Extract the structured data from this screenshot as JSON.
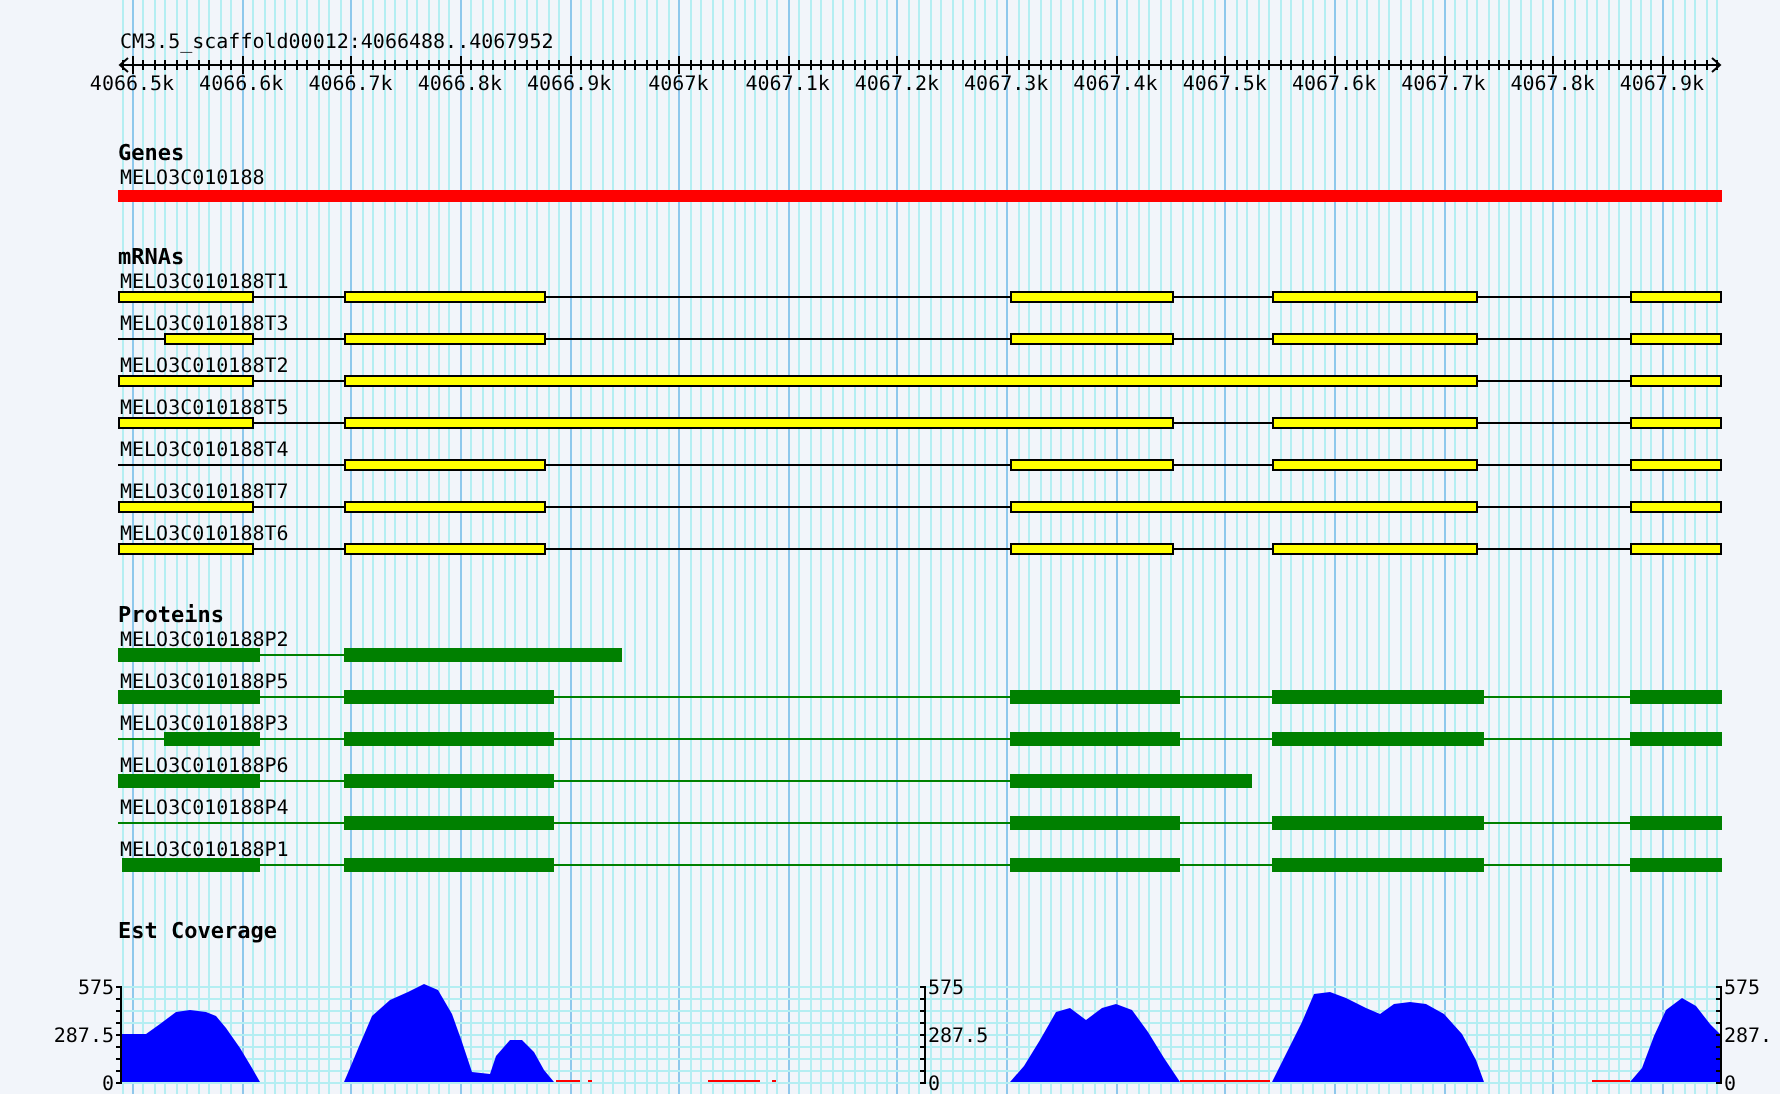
{
  "ruler": {
    "title": "CM3.5_scaffold00012:4066488..4067952",
    "ticks": [
      "4066.5k",
      "4066.6k",
      "4066.7k",
      "4066.8k",
      "4066.9k",
      "4067k",
      "4067.1k",
      "4067.2k",
      "4067.3k",
      "4067.4k",
      "4067.5k",
      "4067.6k",
      "4067.7k",
      "4067.8k",
      "4067.9k"
    ]
  },
  "tracks": [
    {
      "kind": "gene",
      "title": "Genes",
      "features": [
        {
          "label": "MELO3C010188"
        }
      ]
    },
    {
      "kind": "mrna",
      "title": "mRNAs",
      "features": [
        {
          "label": "MELO3C010188T1"
        },
        {
          "label": "MELO3C010188T3"
        },
        {
          "label": "MELO3C010188T2"
        },
        {
          "label": "MELO3C010188T5"
        },
        {
          "label": "MELO3C010188T4"
        },
        {
          "label": "MELO3C010188T7"
        },
        {
          "label": "MELO3C010188T6"
        }
      ]
    },
    {
      "kind": "protein",
      "title": "Proteins",
      "features": [
        {
          "label": "MELO3C010188P2"
        },
        {
          "label": "MELO3C010188P5"
        },
        {
          "label": "MELO3C010188P3"
        },
        {
          "label": "MELO3C010188P6"
        },
        {
          "label": "MELO3C010188P4"
        },
        {
          "label": "MELO3C010188P1"
        }
      ]
    },
    {
      "kind": "coverage",
      "title": "Est Coverage",
      "axes": [
        {
          "kind": "left",
          "labels": [
            "575",
            "287.5",
            "0"
          ]
        },
        {
          "kind": "right",
          "labels": [
            "575",
            "287.5",
            "0"
          ]
        },
        {
          "kind": "right",
          "labels": [
            "575",
            "287.",
            "0"
          ]
        }
      ]
    }
  ]
}
